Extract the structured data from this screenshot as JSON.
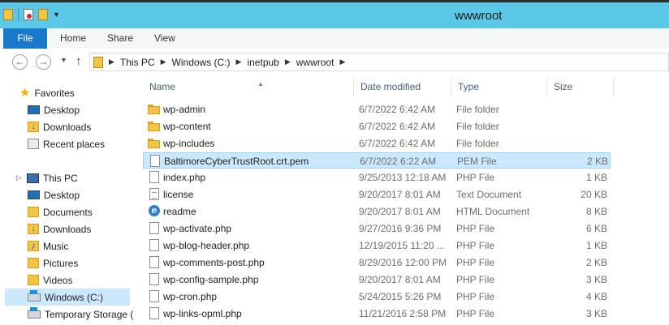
{
  "window": {
    "title": "wwwroot"
  },
  "ribbon": {
    "tabs": [
      "File",
      "Home",
      "Share",
      "View"
    ]
  },
  "address": {
    "segments": [
      "This PC",
      "Windows (C:)",
      "inetpub",
      "wwwroot"
    ]
  },
  "nav": {
    "favorites_label": "Favorites",
    "favorites": [
      "Desktop",
      "Downloads",
      "Recent places"
    ],
    "thispc_label": "This PC",
    "thispc": [
      "Desktop",
      "Documents",
      "Downloads",
      "Music",
      "Pictures",
      "Videos",
      "Windows (C:)",
      "Temporary Storage ("
    ],
    "selected": "Windows (C:)"
  },
  "columns": {
    "name": "Name",
    "date": "Date modified",
    "type": "Type",
    "size": "Size"
  },
  "files": [
    {
      "name": "wp-admin",
      "date": "6/7/2022 6:42 AM",
      "type": "File folder",
      "size": "",
      "icon": "folder-icon"
    },
    {
      "name": "wp-content",
      "date": "6/7/2022 6:42 AM",
      "type": "File folder",
      "size": "",
      "icon": "folder-icon"
    },
    {
      "name": "wp-includes",
      "date": "6/7/2022 6:42 AM",
      "type": "File folder",
      "size": "",
      "icon": "folder-icon"
    },
    {
      "name": "BaltimoreCyberTrustRoot.crt.pem",
      "date": "6/7/2022 6:22 AM",
      "type": "PEM File",
      "size": "2 KB",
      "icon": "file-icon",
      "selected": true
    },
    {
      "name": "index.php",
      "date": "9/25/2013 12:18 AM",
      "type": "PHP File",
      "size": "1 KB",
      "icon": "file-icon"
    },
    {
      "name": "license",
      "date": "9/20/2017 8:01 AM",
      "type": "Text Document",
      "size": "20 KB",
      "icon": "text-document-icon"
    },
    {
      "name": "readme",
      "date": "9/20/2017 8:01 AM",
      "type": "HTML Document",
      "size": "8 KB",
      "icon": "internet-explorer-icon"
    },
    {
      "name": "wp-activate.php",
      "date": "9/27/2016 9:36 PM",
      "type": "PHP File",
      "size": "6 KB",
      "icon": "file-icon"
    },
    {
      "name": "wp-blog-header.php",
      "date": "12/19/2015 11:20 ...",
      "type": "PHP File",
      "size": "1 KB",
      "icon": "file-icon"
    },
    {
      "name": "wp-comments-post.php",
      "date": "8/29/2016 12:00 PM",
      "type": "PHP File",
      "size": "2 KB",
      "icon": "file-icon"
    },
    {
      "name": "wp-config-sample.php",
      "date": "9/20/2017 8:01 AM",
      "type": "PHP File",
      "size": "3 KB",
      "icon": "file-icon"
    },
    {
      "name": "wp-cron.php",
      "date": "5/24/2015 5:26 PM",
      "type": "PHP File",
      "size": "4 KB",
      "icon": "file-icon"
    },
    {
      "name": "wp-links-opml.php",
      "date": "11/21/2016 2:58 PM",
      "type": "PHP File",
      "size": "3 KB",
      "icon": "file-icon"
    }
  ]
}
